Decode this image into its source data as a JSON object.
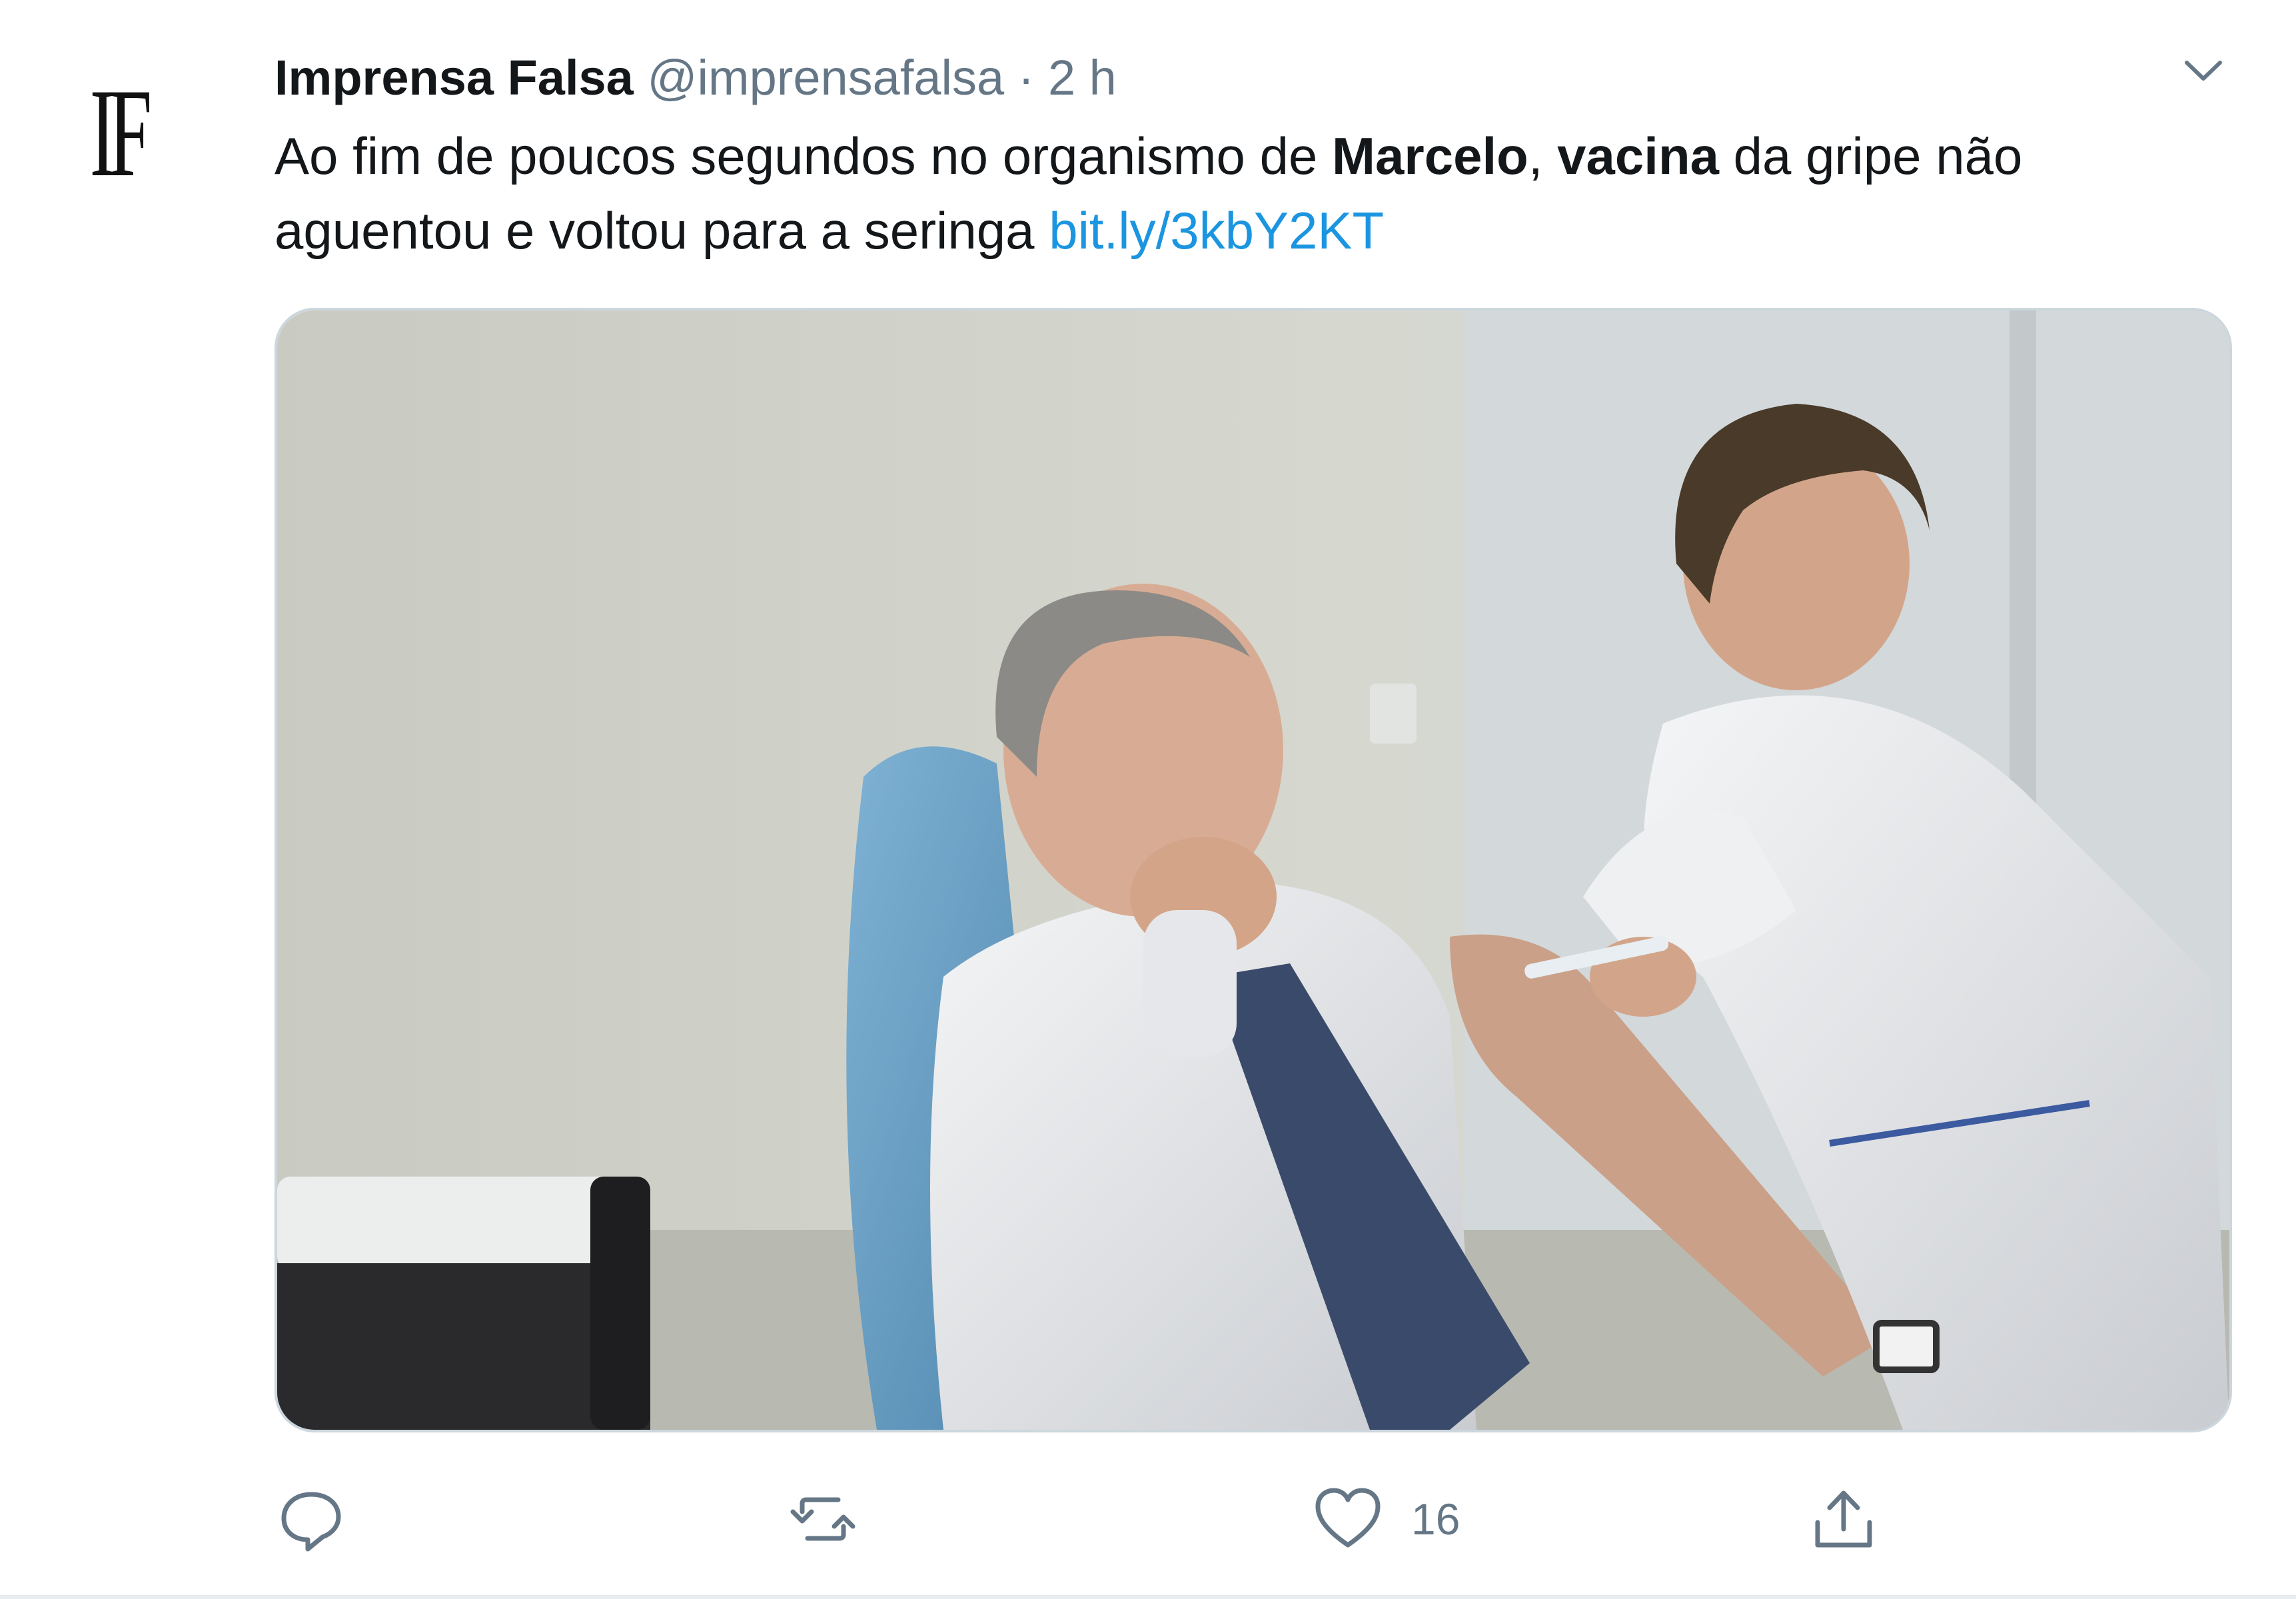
{
  "tweet": {
    "avatar_text": "IF",
    "display_name": "Imprensa Falsa",
    "handle": "@imprensafalsa",
    "separator": "·",
    "time": "2 h",
    "text_part1": "Ao fim de poucos segundos no organismo de ",
    "text_bold1": "Marcelo",
    "text_part2": ", ",
    "text_bold2": "vacina",
    "text_part3": " da gripe não aguentou e voltou para a seringa ",
    "link": "bit.ly/3kbY2KT"
  },
  "actions": {
    "reply_icon": "speech-bubble-icon",
    "retweet_icon": "retweet-arrows-icon",
    "like_icon": "heart-icon",
    "like_count": "16",
    "share_icon": "share-upload-icon"
  },
  "colors": {
    "link": "#1b95e0",
    "secondary_text": "#657786",
    "primary_text": "#14171a",
    "border": "#ccd6dd"
  }
}
